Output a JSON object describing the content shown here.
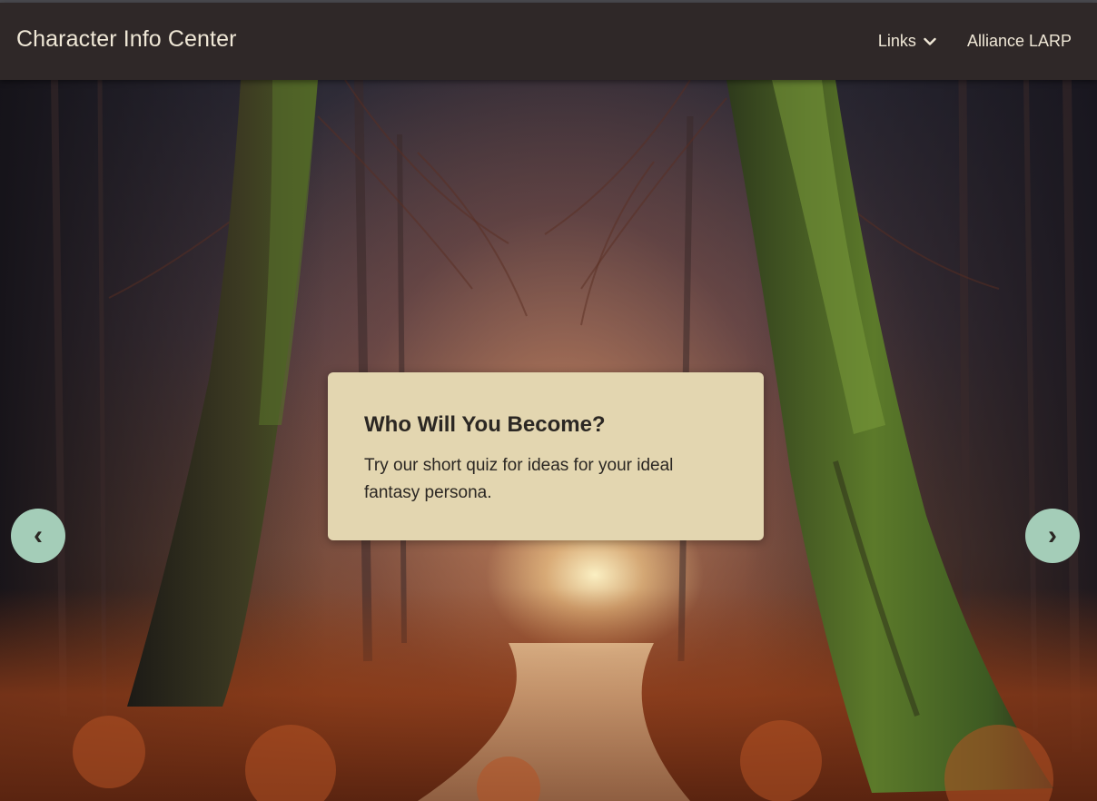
{
  "navbar": {
    "brand": "Character Info Center",
    "links": [
      {
        "label": "Links",
        "has_dropdown": true
      },
      {
        "label": "Alliance LARP",
        "has_dropdown": false
      }
    ]
  },
  "carousel": {
    "slide": {
      "title": "Who Will You Become?",
      "text": "Try our short quiz for ideas for your ideal fantasy persona."
    },
    "prev_label": "‹",
    "next_label": "›"
  },
  "colors": {
    "navbar_bg": "#2f2828",
    "nav_text": "#efe7d6",
    "caption_bg": "#e3d6b0",
    "carousel_button_bg": "#a4cdb8"
  },
  "icons": {
    "dropdown": "chevron-down-icon",
    "prev": "chevron-left-icon",
    "next": "chevron-right-icon"
  }
}
